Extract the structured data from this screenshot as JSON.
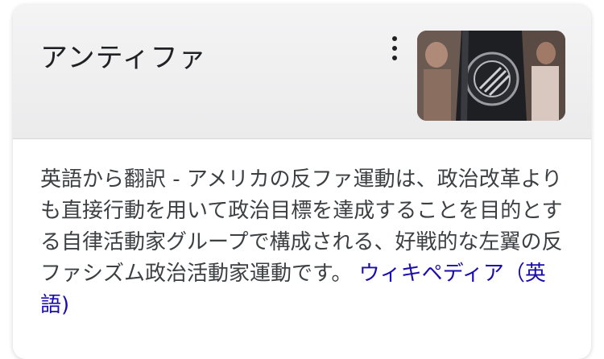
{
  "knowledge_panel": {
    "title": "アンティファ",
    "menu_icon": "more-vert-icon",
    "thumbnail_icon": "antifa-jacket-photo",
    "description": "英語から翻訳 - アメリカの反ファ運動は、政治改革よりも直接行動を用いて政治目標を達成することを目的とする自律活動家グループで構成される、好戦的な左翼の反ファシズム政治活動家運動です。",
    "source_link": "ウィキペディア（英語)"
  }
}
